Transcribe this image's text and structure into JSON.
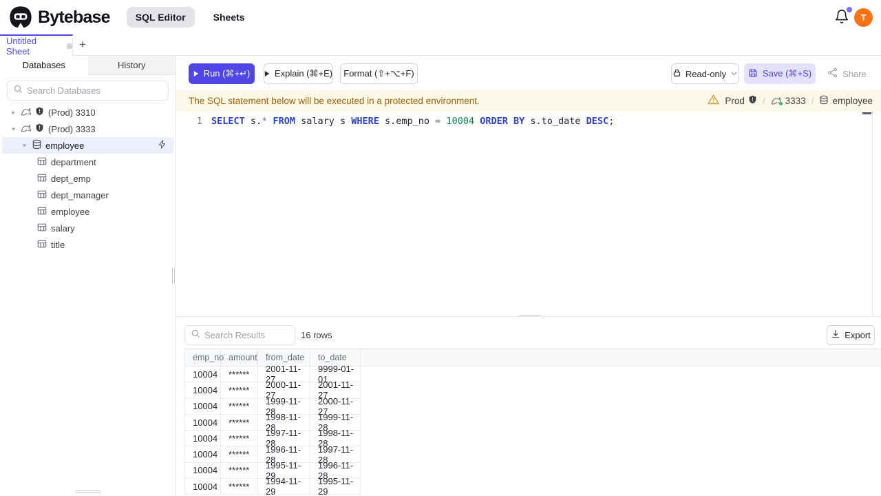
{
  "colors": {
    "accent": "#4f46e5",
    "accent_soft": "#e4e1fb",
    "avatar_orange": "#f97316",
    "warning_bg": "#fcf8e8",
    "warning_text": "#a16207",
    "keyword_blue": "#2c41c8",
    "number_green": "#098658",
    "badge_purple": "#7c6cf2",
    "status_green": "#2fbf71"
  },
  "header": {
    "brand": "Bytebase",
    "tabs": [
      {
        "label": "SQL Editor",
        "active": true
      },
      {
        "label": "Sheets",
        "active": false
      }
    ],
    "avatar": "T"
  },
  "sheet_bar": {
    "active_tab": "Untitled Sheet",
    "add_label": "+"
  },
  "sidebar": {
    "tabs": [
      {
        "label": "Databases",
        "active": true
      },
      {
        "label": "History",
        "active": false
      }
    ],
    "search_placeholder": "Search Databases",
    "instances": [
      {
        "label": "(Prod) 3310",
        "expanded": false
      },
      {
        "label": "(Prod) 3333",
        "expanded": true
      }
    ],
    "database": "employee",
    "tables": [
      "department",
      "dept_emp",
      "dept_manager",
      "employee",
      "salary",
      "title"
    ]
  },
  "toolbar": {
    "run": "Run (⌘+↵)",
    "explain": "Explain (⌘+E)",
    "format": "Format (⇧+⌥+F)",
    "readonly": "Read-only",
    "save": "Save (⌘+S)",
    "share": "Share"
  },
  "banner": {
    "message": "The SQL statement below will be executed in a protected environment.",
    "environment": "Prod",
    "instance": "3333",
    "database": "employee",
    "separator": "/"
  },
  "editor": {
    "line_number": "1",
    "statement": "SELECT s.* FROM salary s WHERE s.emp_no = 10004 ORDER BY s.to_date DESC;",
    "tokens": [
      {
        "text": "SELECT",
        "type": "kw"
      },
      {
        "text": " s.",
        "type": "id"
      },
      {
        "text": "*",
        "type": "op"
      },
      {
        "text": " ",
        "type": "id"
      },
      {
        "text": "FROM",
        "type": "kw"
      },
      {
        "text": " salary s ",
        "type": "id"
      },
      {
        "text": "WHERE",
        "type": "kw"
      },
      {
        "text": " s.emp_no ",
        "type": "id"
      },
      {
        "text": "=",
        "type": "op"
      },
      {
        "text": " ",
        "type": "id"
      },
      {
        "text": "10004",
        "type": "num"
      },
      {
        "text": " ",
        "type": "id"
      },
      {
        "text": "ORDER BY",
        "type": "kw"
      },
      {
        "text": " s.to_date ",
        "type": "id"
      },
      {
        "text": "DESC",
        "type": "kw"
      },
      {
        "text": ";",
        "type": "id"
      }
    ]
  },
  "results": {
    "search_placeholder": "Search Results",
    "row_count": "16 rows",
    "export_label": "Export",
    "columns": [
      "emp_no",
      "amount",
      "from_date",
      "to_date"
    ],
    "rows": [
      [
        "10004",
        "******",
        "2001-11-27",
        "9999-01-01"
      ],
      [
        "10004",
        "******",
        "2000-11-27",
        "2001-11-27"
      ],
      [
        "10004",
        "******",
        "1999-11-28",
        "2000-11-27"
      ],
      [
        "10004",
        "******",
        "1998-11-28",
        "1999-11-28"
      ],
      [
        "10004",
        "******",
        "1997-11-28",
        "1998-11-28"
      ],
      [
        "10004",
        "******",
        "1996-11-28",
        "1997-11-28"
      ],
      [
        "10004",
        "******",
        "1995-11-29",
        "1996-11-28"
      ],
      [
        "10004",
        "******",
        "1994-11-29",
        "1995-11-29"
      ]
    ]
  }
}
